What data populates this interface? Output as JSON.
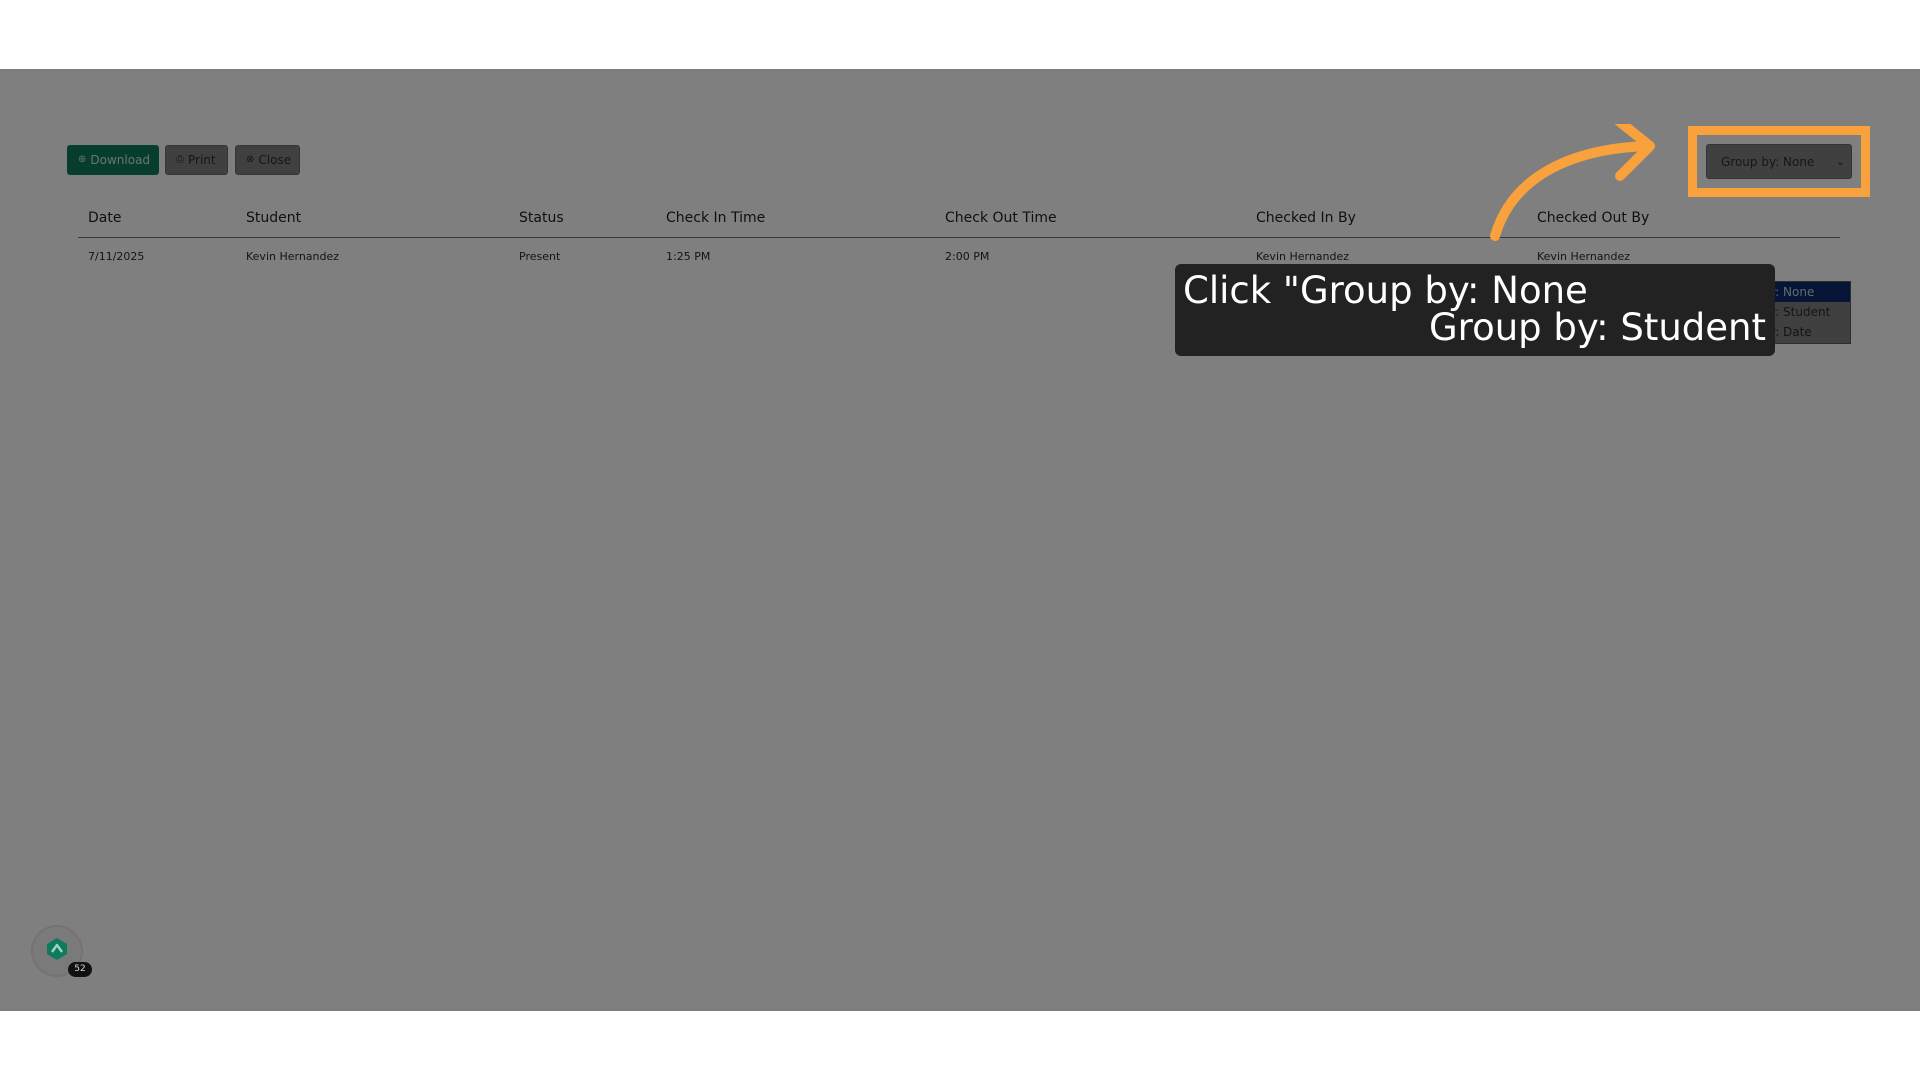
{
  "toolbar": {
    "download_label": "Download",
    "print_label": "Print",
    "close_label": "Close"
  },
  "group_by": {
    "selected": "Group by: None",
    "options": [
      "Group by: None",
      "Group by: Student",
      "Group by: Date"
    ]
  },
  "table": {
    "columns": [
      "Date",
      "Student",
      "Status",
      "Check In Time",
      "Check Out Time",
      "Checked In By",
      "Checked Out By"
    ],
    "rows": [
      [
        "7/11/2025",
        "Kevin Hernandez",
        "Present",
        "1:25 PM",
        "2:00 PM",
        "Kevin Hernandez",
        "Kevin Hernandez"
      ]
    ]
  },
  "tooltip": {
    "line1": "Click \"Group by: None",
    "line2": "Group by: Student"
  },
  "widget": {
    "badge": "52"
  },
  "colors": {
    "highlight": "#f9a23d",
    "download_bg": "#0f7a5e",
    "selected_option": "#0d2b6b"
  }
}
